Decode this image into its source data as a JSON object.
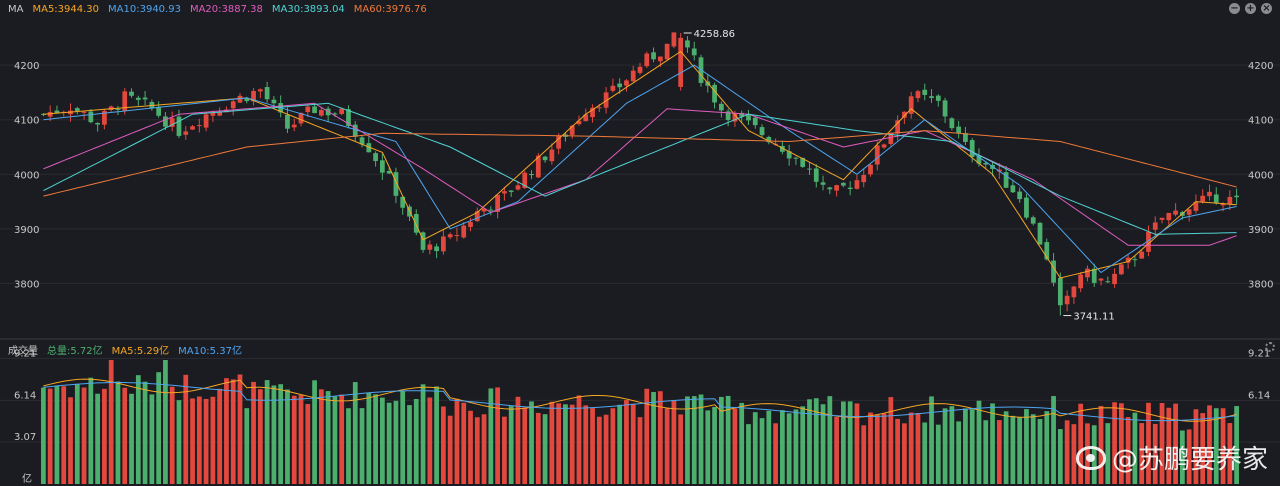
{
  "price_panel": {
    "indicator_label": "MA",
    "ma_legend": [
      {
        "text": "MA5:3944.30",
        "color": "#f5a623"
      },
      {
        "text": "MA10:3940.93",
        "color": "#4ea5f0"
      },
      {
        "text": "MA20:3887.38",
        "color": "#e05cc0"
      },
      {
        "text": "MA30:3893.04",
        "color": "#4fd3d3"
      },
      {
        "text": "MA60:3976.76",
        "color": "#f07a3a"
      }
    ],
    "y_ticks": [
      "4200",
      "4100",
      "4000",
      "3900",
      "3800"
    ],
    "high_marker": "4258.86",
    "low_marker": "3741.11"
  },
  "volume_panel": {
    "title": "成交量",
    "legend": [
      {
        "text": "总量:5.72亿",
        "color": "#4caf6e"
      },
      {
        "text": "MA5:5.29亿",
        "color": "#f5a623"
      },
      {
        "text": "MA10:5.37亿",
        "color": "#4ea5f0"
      }
    ],
    "y_ticks": [
      "9.21",
      "6.14",
      "3.07"
    ],
    "unit": "亿",
    "right_partial_tick": "3.07"
  },
  "watermark": "@苏鹏要养家",
  "colors": {
    "up": "#e2483d",
    "down": "#4caf6e",
    "background": "#1b1c21",
    "grid": "#2a2b31",
    "ma5": "#f5a623",
    "ma10": "#4ea5f0",
    "ma20": "#e05cc0",
    "ma30": "#4fd3d3",
    "ma60": "#f07a3a"
  },
  "chart_data": {
    "type": "candlestick",
    "price_range": [
      3700,
      4290
    ],
    "volume_range": [
      0,
      9.21
    ],
    "bars": 130,
    "price_anchors": [
      [
        0,
        4110
      ],
      [
        4,
        4125
      ],
      [
        8,
        4095
      ],
      [
        12,
        4140
      ],
      [
        16,
        4120
      ],
      [
        20,
        4080
      ],
      [
        24,
        4110
      ],
      [
        28,
        4135
      ],
      [
        32,
        4155
      ],
      [
        36,
        4085
      ],
      [
        40,
        4120
      ],
      [
        44,
        4110
      ],
      [
        48,
        4050
      ],
      [
        52,
        3970
      ],
      [
        56,
        3860
      ],
      [
        60,
        3880
      ],
      [
        64,
        3930
      ],
      [
        68,
        3960
      ],
      [
        72,
        4010
      ],
      [
        76,
        4060
      ],
      [
        80,
        4120
      ],
      [
        84,
        4150
      ],
      [
        88,
        4200
      ],
      [
        92,
        4235
      ],
      [
        94,
        4258.86
      ],
      [
        97,
        4180
      ],
      [
        100,
        4120
      ],
      [
        104,
        4090
      ],
      [
        108,
        4060
      ],
      [
        112,
        4020
      ],
      [
        116,
        3960
      ],
      [
        120,
        3990
      ],
      [
        124,
        4060
      ],
      [
        128,
        4145
      ],
      [
        132,
        4130
      ],
      [
        136,
        4050
      ],
      [
        140,
        4010
      ],
      [
        144,
        3960
      ],
      [
        148,
        3850
      ],
      [
        150,
        3741.11
      ],
      [
        153,
        3820
      ],
      [
        157,
        3800
      ],
      [
        161,
        3850
      ],
      [
        165,
        3920
      ],
      [
        169,
        3940
      ],
      [
        173,
        3960
      ],
      [
        176,
        3950
      ]
    ],
    "ma_anchors": {
      "MA5": [
        [
          0,
          4110
        ],
        [
          30,
          4140
        ],
        [
          50,
          4040
        ],
        [
          56,
          3880
        ],
        [
          64,
          3930
        ],
        [
          80,
          4110
        ],
        [
          94,
          4225
        ],
        [
          104,
          4080
        ],
        [
          118,
          3990
        ],
        [
          128,
          4120
        ],
        [
          140,
          4000
        ],
        [
          150,
          3810
        ],
        [
          160,
          3840
        ],
        [
          170,
          3950
        ],
        [
          176,
          3944.3
        ]
      ],
      "MA10": [
        [
          0,
          4100
        ],
        [
          30,
          4140
        ],
        [
          52,
          4060
        ],
        [
          60,
          3900
        ],
        [
          70,
          3950
        ],
        [
          86,
          4130
        ],
        [
          96,
          4200
        ],
        [
          110,
          4080
        ],
        [
          120,
          4000
        ],
        [
          130,
          4100
        ],
        [
          144,
          3980
        ],
        [
          156,
          3820
        ],
        [
          168,
          3920
        ],
        [
          176,
          3940.93
        ]
      ],
      "MA20": [
        [
          0,
          4010
        ],
        [
          20,
          4110
        ],
        [
          40,
          4130
        ],
        [
          56,
          4010
        ],
        [
          66,
          3930
        ],
        [
          80,
          3990
        ],
        [
          92,
          4120
        ],
        [
          104,
          4110
        ],
        [
          118,
          4050
        ],
        [
          130,
          4080
        ],
        [
          146,
          3990
        ],
        [
          160,
          3870
        ],
        [
          172,
          3870
        ],
        [
          176,
          3887.38
        ]
      ],
      "MA30": [
        [
          0,
          3970
        ],
        [
          22,
          4110
        ],
        [
          42,
          4130
        ],
        [
          60,
          4050
        ],
        [
          74,
          3960
        ],
        [
          90,
          4040
        ],
        [
          104,
          4110
        ],
        [
          120,
          4080
        ],
        [
          134,
          4060
        ],
        [
          150,
          3960
        ],
        [
          164,
          3890
        ],
        [
          176,
          3893.04
        ]
      ],
      "MA60": [
        [
          0,
          3960
        ],
        [
          30,
          4050
        ],
        [
          50,
          4075
        ],
        [
          80,
          4070
        ],
        [
          110,
          4060
        ],
        [
          130,
          4080
        ],
        [
          150,
          4060
        ],
        [
          176,
          3976.76
        ]
      ]
    },
    "volume_summary": {
      "total": 5.72,
      "MA5": 5.29,
      "MA10": 5.37,
      "unit": "亿"
    }
  }
}
